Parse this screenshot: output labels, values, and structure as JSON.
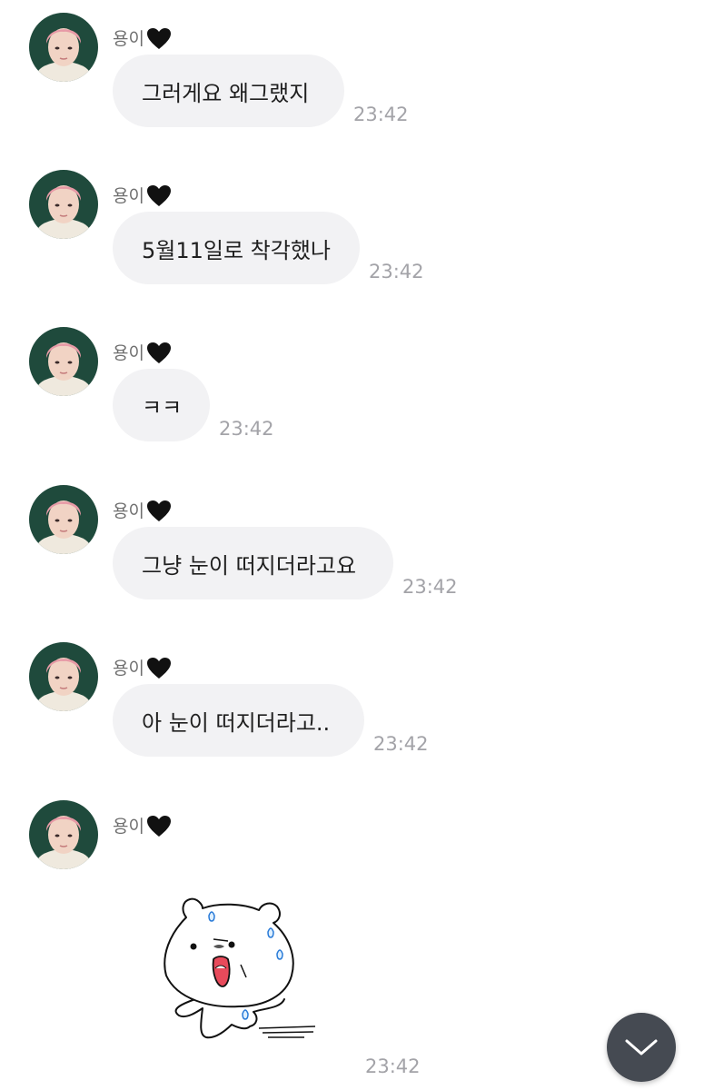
{
  "chat": {
    "messages": [
      {
        "sender": "용이",
        "text": "그러게요 왜그랬지",
        "time": "23:42"
      },
      {
        "sender": "용이",
        "text": "5월11일로 착각했나",
        "time": "23:42"
      },
      {
        "sender": "용이",
        "text": "ㅋㅋ",
        "time": "23:42"
      },
      {
        "sender": "용이",
        "text": "그냥 눈이 떠지더라고요",
        "time": "23:42"
      },
      {
        "sender": "용이",
        "text": "아 눈이 떠지더라고..",
        "time": "23:42"
      },
      {
        "sender": "용이",
        "sticker": "sweating-bear-sticker",
        "time": "23:42"
      }
    ]
  },
  "icons": {
    "sender_badge": "black-heart-icon",
    "scroll_button": "chevron-down-icon"
  },
  "colors": {
    "bubble_bg": "#f2f2f4",
    "timestamp": "#a3a3a8",
    "scroll_button_bg": "#454a52"
  }
}
